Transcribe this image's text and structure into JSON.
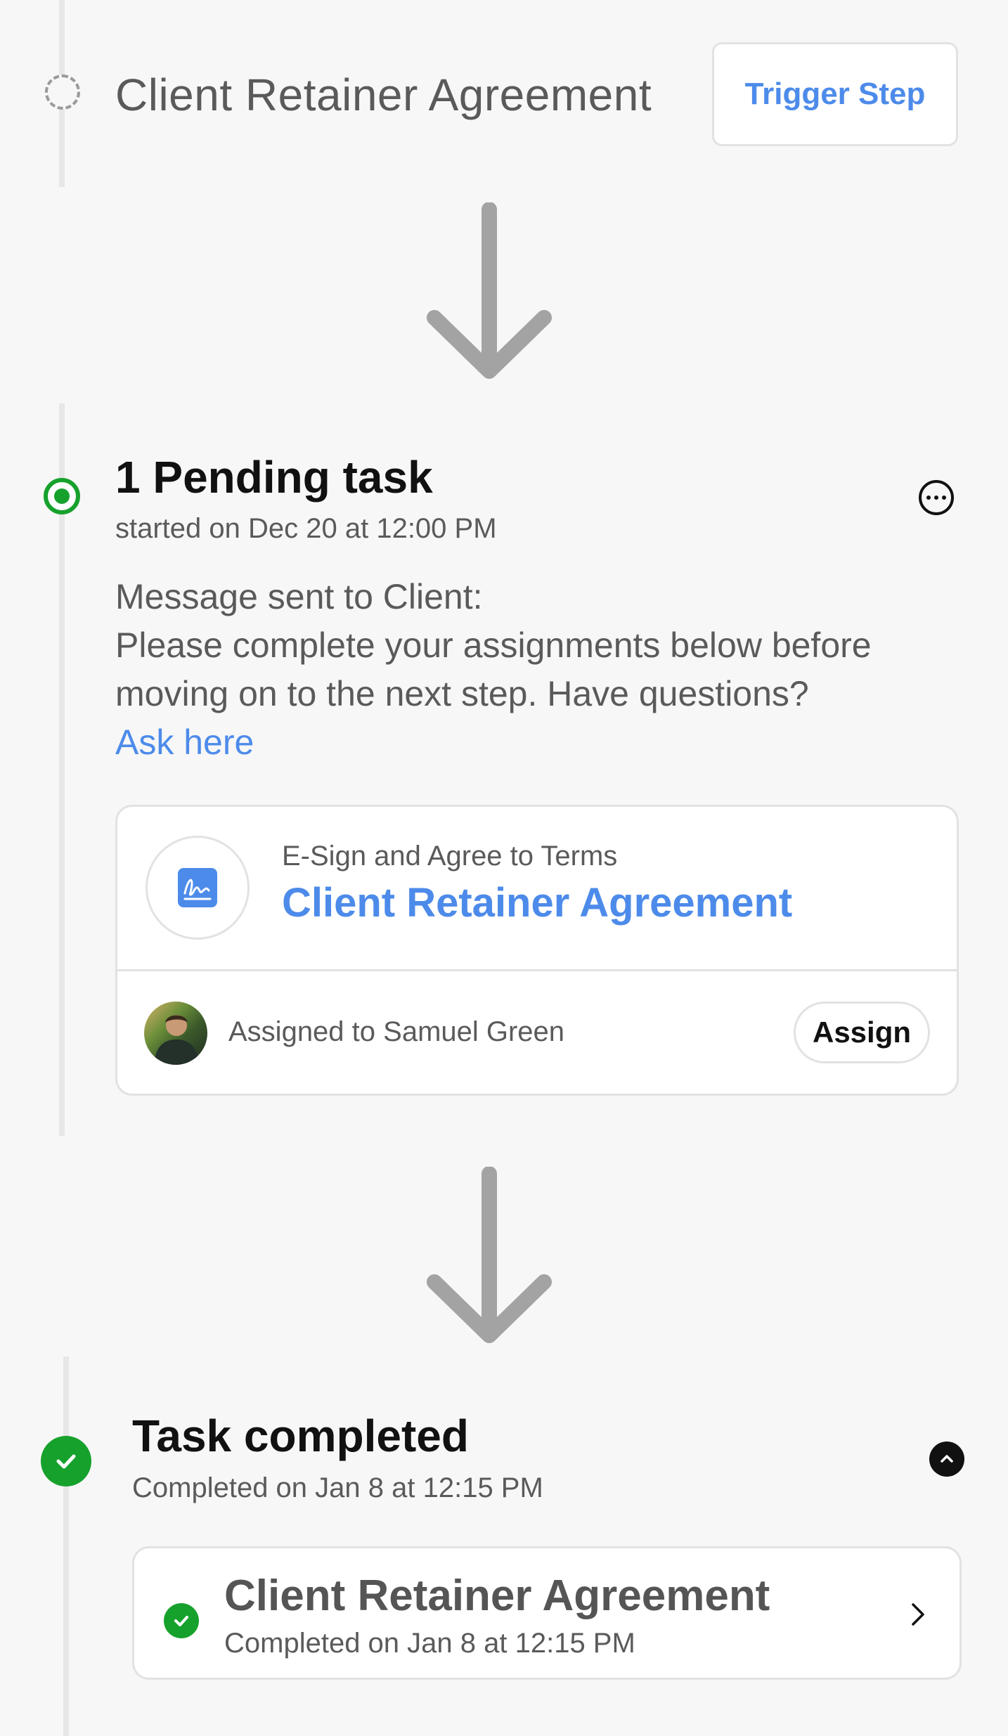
{
  "step_trigger": {
    "title": "Client Retainer Agreement",
    "button_label": "Trigger Step"
  },
  "step_pending": {
    "title": "1 Pending task",
    "started": "started on Dec 20 at 12:00 PM",
    "message_line1": "Message sent to Client:",
    "message_body": "Please complete your assignments below before moving on to the next step. Have questions?",
    "ask_link": "Ask here",
    "task": {
      "type_label": "E-Sign and Agree to Terms",
      "name": "Client Retainer Agreement",
      "assigned_text": "Assigned to Samuel Green",
      "assign_button": "Assign"
    }
  },
  "step_completed": {
    "title": "Task completed",
    "completed": "Completed on Jan 8 at 12:15 PM",
    "item": {
      "name": "Client Retainer Agreement",
      "completed": "Completed on Jan 8 at 12:15 PM"
    }
  },
  "colors": {
    "accent_blue": "#4d8bea",
    "success_green": "#16a12c",
    "arrow_gray": "#a3a3a3"
  }
}
